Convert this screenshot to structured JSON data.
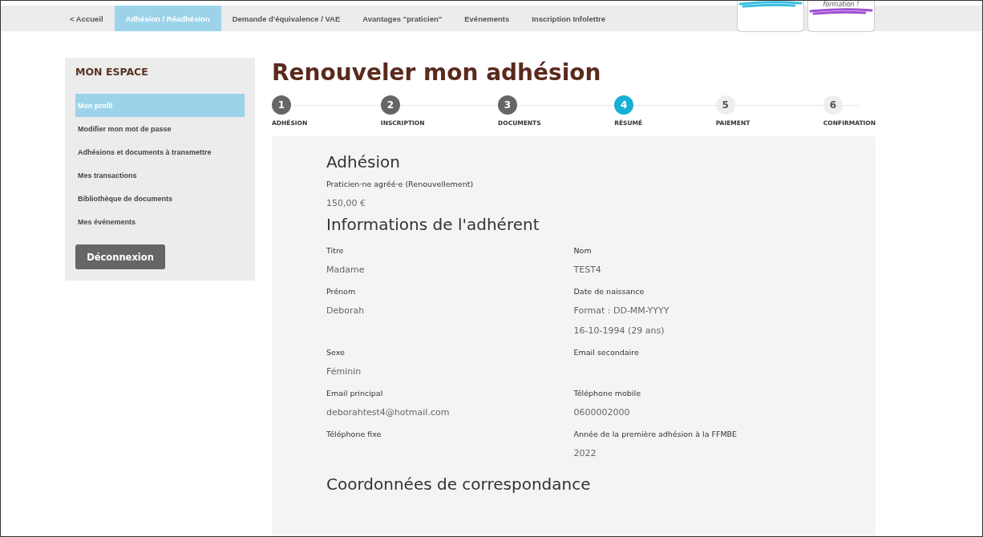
{
  "nav": {
    "items": [
      {
        "label": "< Accueil",
        "selected": false
      },
      {
        "label": "Adhésion / Réadhésion",
        "selected": true
      },
      {
        "label": "Demande d'équivalence / VAE",
        "selected": false
      },
      {
        "label": "Avantages \"praticien\"",
        "selected": false
      },
      {
        "label": "Evénements",
        "selected": false
      },
      {
        "label": "Inscription Infolettre",
        "selected": false
      }
    ],
    "logos": [
      {
        "color": "#3bbfe0"
      },
      {
        "text": "formation !",
        "color": "#a04fd0"
      }
    ]
  },
  "sidebar": {
    "title": "MON ESPACE",
    "items": [
      {
        "label": "Mon profil",
        "selected": true
      },
      {
        "label": "Modifier mon mot de passe",
        "selected": false
      },
      {
        "label": "Adhésions et documents à transmettre",
        "selected": false
      },
      {
        "label": "Mes transactions",
        "selected": false
      },
      {
        "label": "Bibliothèque de documents",
        "selected": false
      },
      {
        "label": "Mes événements",
        "selected": false
      }
    ],
    "logout": "Déconnexion"
  },
  "page_title": "Renouveler mon adhésion",
  "steps": [
    {
      "number": "1",
      "label": "ADHÉSION",
      "kind": "done"
    },
    {
      "number": "2",
      "label": "INSCRIPTION",
      "kind": "done"
    },
    {
      "number": "3",
      "label": "DOCUMENTS",
      "kind": "done"
    },
    {
      "number": "4",
      "label": "RÉSUMÉ",
      "kind": "active"
    },
    {
      "number": "5",
      "label": "PAIEMENT",
      "kind": "pending"
    },
    {
      "number": "6",
      "label": "CONFIRMATION",
      "kind": "pending"
    }
  ],
  "summary": {
    "membership": {
      "heading": "Adhésion",
      "type": "Praticien·ne agréé·e (Renouvellement)",
      "price": "150,00 €"
    },
    "member": {
      "heading": "Informations de l'adhérent",
      "fields": [
        {
          "label": "Titre",
          "values": [
            "Madame"
          ]
        },
        {
          "label": "Nom",
          "values": [
            "TEST4"
          ]
        },
        {
          "label": "Prénom",
          "values": [
            "Deborah"
          ]
        },
        {
          "label": "Date de naissance",
          "values": [
            "Format : DD-MM-YYYY",
            "16-10-1994 (29 ans)"
          ]
        },
        {
          "label": "Sexe",
          "values": [
            "Féminin"
          ]
        },
        {
          "label": "Email secondaire"
        },
        {
          "label": "Email principal",
          "values": [
            "deborahtest4@hotmail.com"
          ]
        },
        {
          "label": "Téléphone mobile",
          "values": [
            "0600002000"
          ]
        },
        {
          "label": "Téléphone fixe"
        },
        {
          "label": "Année de la première adhésion à la FFMBE",
          "values": [
            "2022"
          ]
        }
      ]
    },
    "next_heading": "Coordonnées de correspondance"
  }
}
